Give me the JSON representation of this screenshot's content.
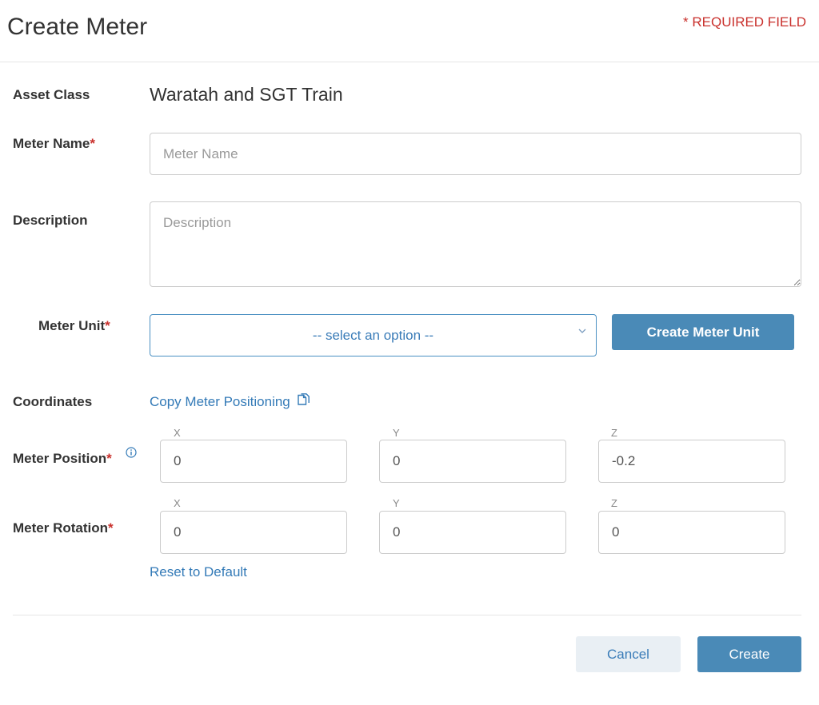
{
  "header": {
    "title": "Create Meter",
    "required_note": "* REQUIRED FIELD"
  },
  "asset_class": {
    "label": "Asset Class",
    "value": "Waratah and SGT Train"
  },
  "meter_name": {
    "label": "Meter Name",
    "required_mark": "*",
    "placeholder": "Meter Name",
    "value": ""
  },
  "description": {
    "label": "Description",
    "placeholder": "Description",
    "value": ""
  },
  "meter_unit": {
    "label": "Meter Unit",
    "required_mark": "*",
    "selected": "-- select an option --",
    "create_button": "Create Meter Unit"
  },
  "coordinates": {
    "label": "Coordinates",
    "copy_link": "Copy Meter Positioning",
    "copy_icon": "copy-icon"
  },
  "meter_position": {
    "label": "Meter Position",
    "required_mark": "*",
    "info_icon": "info-icon",
    "axes": [
      "X",
      "Y",
      "Z"
    ],
    "values": [
      "0",
      "0",
      "-0.2"
    ]
  },
  "meter_rotation": {
    "label": "Meter Rotation",
    "required_mark": "*",
    "axes": [
      "X",
      "Y",
      "Z"
    ],
    "values": [
      "0",
      "0",
      "0"
    ]
  },
  "reset_link": "Reset to Default",
  "footer": {
    "cancel_label": "Cancel",
    "create_label": "Create"
  },
  "colors": {
    "primary": "#4a8ab7",
    "link": "#337ab7",
    "required": "#c9302c",
    "cancel_bg": "#e9eff4"
  }
}
